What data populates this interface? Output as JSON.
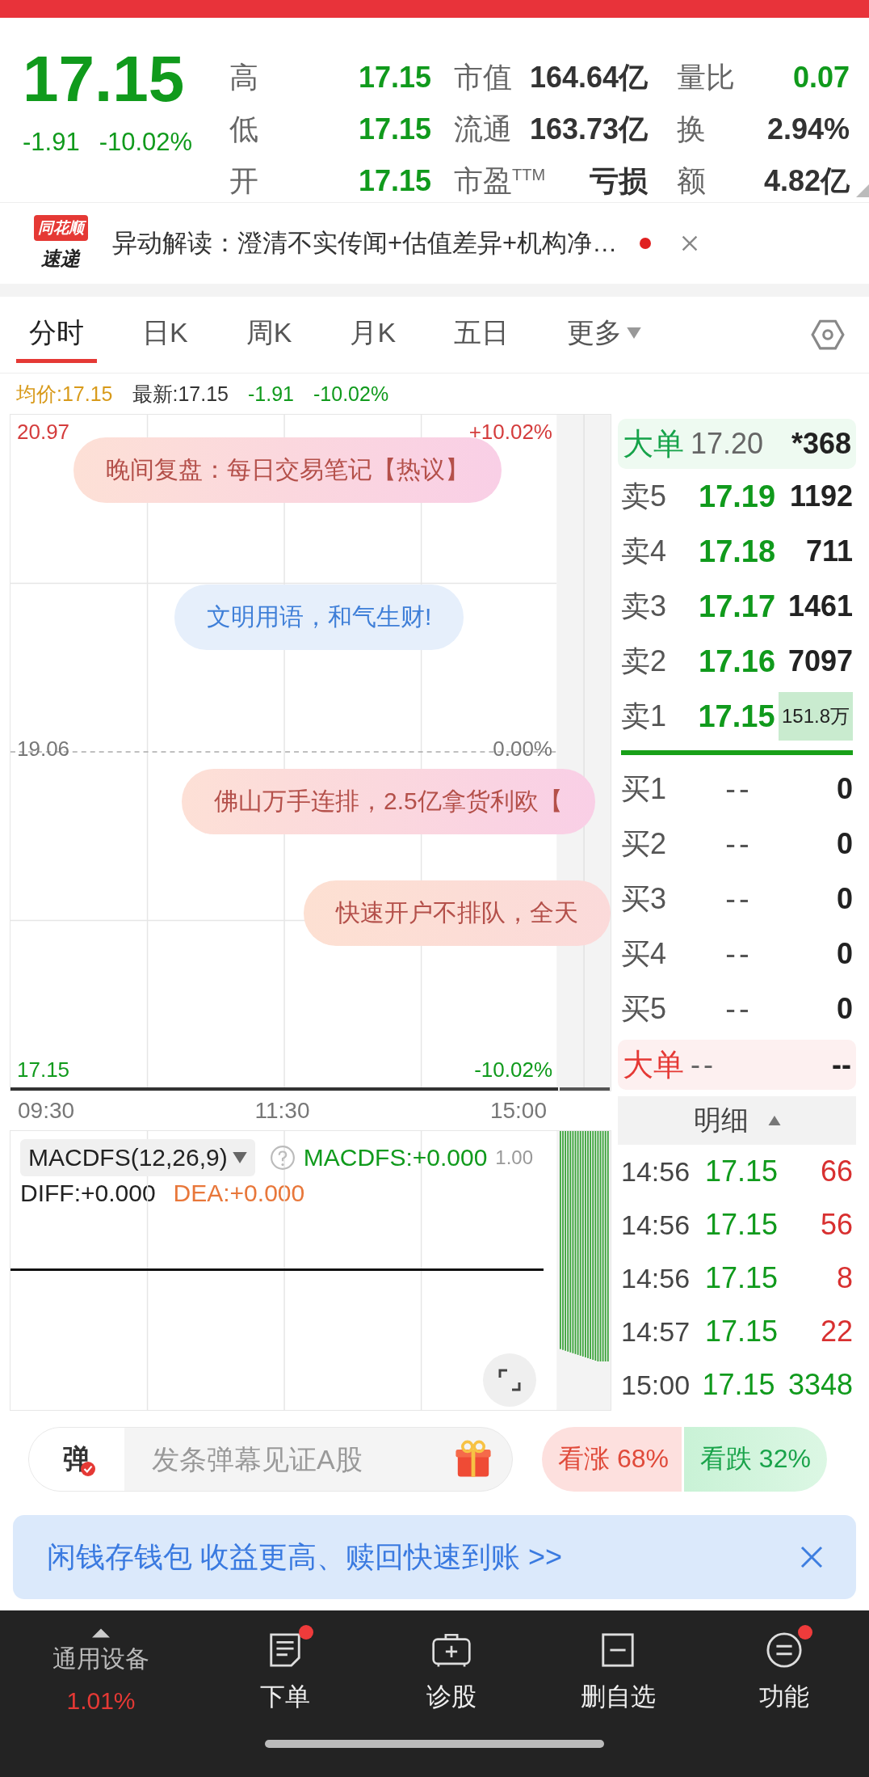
{
  "quote": {
    "price": "17.15",
    "change": "-1.91",
    "change_pct": "-10.02%",
    "rows": [
      [
        {
          "label": "高",
          "value": "17.15",
          "color": "#109a1c"
        },
        {
          "label": "市值",
          "value": "164.64亿",
          "color": "#333333"
        },
        {
          "label": "量比",
          "value": "0.07",
          "color": "#109a1c"
        }
      ],
      [
        {
          "label": "低",
          "value": "17.15",
          "color": "#109a1c"
        },
        {
          "label": "流通",
          "value": "163.73亿",
          "color": "#333333"
        },
        {
          "label": "换",
          "value": "2.94%",
          "color": "#333333"
        }
      ],
      [
        {
          "label": "开",
          "value": "17.15",
          "color": "#109a1c"
        },
        {
          "label": "市盈$^{TTM}$",
          "value": "亏损",
          "color": "#333333"
        },
        {
          "label": "额",
          "value": "4.82亿",
          "color": "#333333"
        }
      ]
    ]
  },
  "news": {
    "logo_top": "同花顺",
    "logo_bottom": "速递",
    "text": "异动解读：澄清不实传闻+估值差异+机构净…",
    "unread": true
  },
  "tabs": [
    {
      "label": "分时",
      "kind": "tab",
      "selected": true
    },
    {
      "label": "日K",
      "kind": "tab",
      "selected": false
    },
    {
      "label": "周K",
      "kind": "tab",
      "selected": false
    },
    {
      "label": "月K",
      "kind": "tab",
      "selected": false
    },
    {
      "label": "五日",
      "kind": "tab",
      "selected": false
    },
    {
      "label": "更多",
      "kind": "menu",
      "selected": false
    }
  ],
  "info_line": {
    "average": "均价:17.15",
    "latest": "最新:17.15",
    "change": "-1.91",
    "change_pct": "-10.02%"
  },
  "chart": {
    "top_price": "20.97",
    "top_pct": "+10.02%",
    "mid_price": "19.06",
    "mid_pct": "0.00%",
    "bottom_price": "17.15",
    "bottom_pct": "-10.02%",
    "times": [
      "09:30",
      "11:30",
      "15:00"
    ]
  },
  "danmaku": [
    {
      "text": "晚间复盘：每日交易笔记【热议】",
      "kind": "pink"
    },
    {
      "text": "文明用语，和气生财!",
      "kind": "blue"
    },
    {
      "text": "佛山万手连排，2.5亿拿货利欧【",
      "kind": "pink"
    },
    {
      "text": "快速开户不排队，全天",
      "kind": "peach"
    }
  ],
  "macd": {
    "indicator": "MACDFS(12,26,9)",
    "value": "MACDFS:+0.000",
    "axis_value": "1.00",
    "diff": "DIFF:+0.000",
    "dea": "DEA:+0.000"
  },
  "orderbook": {
    "big_top": {
      "label": "大单",
      "price": "17.20",
      "volume": "*368"
    },
    "asks": [
      {
        "label": "卖5",
        "price": "17.19",
        "volume": "1192",
        "highlight": false
      },
      {
        "label": "卖4",
        "price": "17.18",
        "volume": "711",
        "highlight": false
      },
      {
        "label": "卖3",
        "price": "17.17",
        "volume": "1461",
        "highlight": false
      },
      {
        "label": "卖2",
        "price": "17.16",
        "volume": "7097",
        "highlight": false
      },
      {
        "label": "卖1",
        "price": "17.15",
        "volume": "151.8万",
        "highlight": true
      }
    ],
    "bids": [
      {
        "label": "买1",
        "price": "--",
        "volume": "0",
        "highlight": false
      },
      {
        "label": "买2",
        "price": "--",
        "volume": "0",
        "highlight": false
      },
      {
        "label": "买3",
        "price": "--",
        "volume": "0",
        "highlight": false
      },
      {
        "label": "买4",
        "price": "--",
        "volume": "0",
        "highlight": false
      },
      {
        "label": "买5",
        "price": "--",
        "volume": "0",
        "highlight": false
      }
    ],
    "big_bottom": {
      "label": "大单",
      "price": "--",
      "volume": "--"
    }
  },
  "detail": {
    "title": "明细",
    "trades": [
      {
        "time": "14:56",
        "price": "17.15",
        "volume": "66",
        "color": "#d83030"
      },
      {
        "time": "14:56",
        "price": "17.15",
        "volume": "56",
        "color": "#d83030"
      },
      {
        "time": "14:56",
        "price": "17.15",
        "volume": "8",
        "color": "#d83030"
      },
      {
        "time": "14:57",
        "price": "17.15",
        "volume": "22",
        "color": "#d83030"
      },
      {
        "time": "15:00",
        "price": "17.15",
        "volume": "3348",
        "color": "#109a1c"
      }
    ]
  },
  "comment_bar": {
    "badge": "弹",
    "placeholder": "发条弹幕见证A股",
    "bull": "看涨 68%",
    "bear": "看跌 32%"
  },
  "banner": {
    "text": "闲钱存钱包 收益更高、赎回快速到账 >>"
  },
  "bottom_nav": {
    "sector": {
      "name": "通用设备",
      "change": "1.01%"
    },
    "items": [
      {
        "label": "下单",
        "badge": true
      },
      {
        "label": "诊股",
        "badge": false
      },
      {
        "label": "删自选",
        "badge": false
      },
      {
        "label": "功能",
        "badge": true
      }
    ]
  }
}
